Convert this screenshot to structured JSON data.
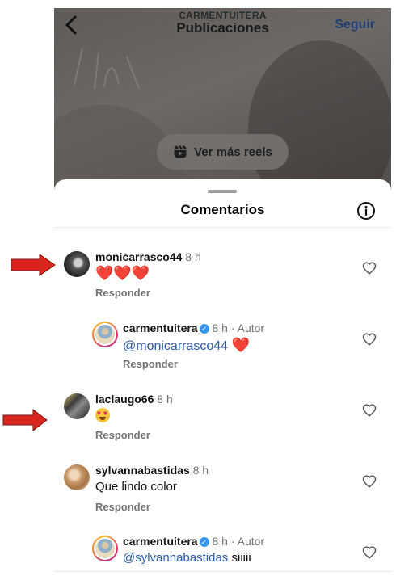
{
  "topbar": {
    "account": "CARMENTUITERA",
    "title": "Publicaciones",
    "follow_label": "Seguir"
  },
  "reels_button": {
    "label": "Ver más reels"
  },
  "sheet": {
    "title": "Comentarios"
  },
  "comments": [
    {
      "username": "monicarrasco44",
      "time": "8 h",
      "text": "❤️❤️❤️",
      "reply_label": "Responder"
    },
    {
      "username": "carmentuitera",
      "time": "8 h · Autor",
      "mention": "@monicarrasco44",
      "text": "❤️",
      "reply_label": "Responder"
    },
    {
      "username": "laclaugo66",
      "time": "8 h",
      "text": "😍",
      "reply_label": "Responder"
    },
    {
      "username": "sylvannabastidas",
      "time": "8 h",
      "text": "Que lindo color",
      "reply_label": "Responder"
    },
    {
      "username": "carmentuitera",
      "time": "8 h · Autor",
      "mention": "@sylvannabastidas",
      "text": "siiiii"
    }
  ],
  "colors": {
    "mention": "#2b5ca8",
    "follow": "#1d3f7a",
    "arrow": "#d9261c",
    "verified": "#3897f0"
  },
  "icons": [
    "back-chevron-icon",
    "reels-icon",
    "info-icon",
    "heart-icon",
    "verified-badge-icon",
    "red-arrow"
  ]
}
